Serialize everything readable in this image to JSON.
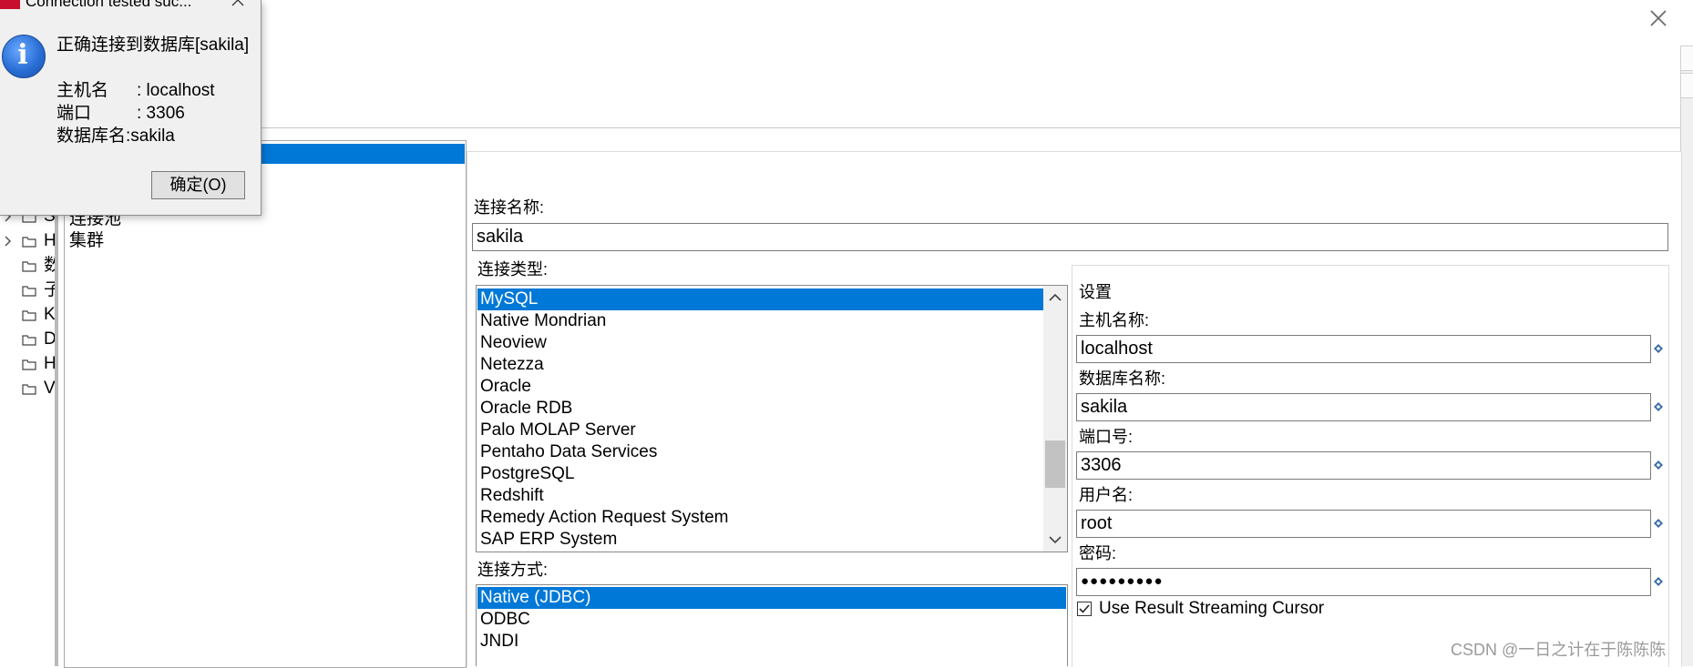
{
  "dialog": {
    "title": "Connection tested suc...",
    "message": "正确连接到数据库[sakila]",
    "host_label": "主机名",
    "host_value": ": localhost",
    "port_label": "端口",
    "port_value": ": 3306",
    "db_line": "数据库名:sakila",
    "ok_label": "确定(O)"
  },
  "tree": {
    "items": [
      {
        "label": "S",
        "expandable": true
      },
      {
        "label": "H",
        "expandable": true
      },
      {
        "label": "数",
        "expandable": false
      },
      {
        "label": "子",
        "expandable": false
      },
      {
        "label": "K",
        "expandable": false
      },
      {
        "label": "D",
        "expandable": false
      },
      {
        "label": "H",
        "expandable": false
      },
      {
        "label": "V",
        "expandable": false
      }
    ]
  },
  "categories": {
    "items": [
      "连接池",
      "集群"
    ]
  },
  "form": {
    "connection_name_label": "连接名称:",
    "connection_name_value": "sakila",
    "connection_type_label": "连接类型:",
    "connection_types": [
      "MySQL",
      "Native Mondrian",
      "Neoview",
      "Netezza",
      "Oracle",
      "Oracle RDB",
      "Palo MOLAP Server",
      "Pentaho Data Services",
      "PostgreSQL",
      "Redshift",
      "Remedy Action Request System",
      "SAP ERP System"
    ],
    "selected_type": "MySQL",
    "access_label": "连接方式:",
    "access_methods": [
      "Native (JDBC)",
      "ODBC",
      "JNDI"
    ],
    "selected_access": "Native (JDBC)"
  },
  "settings": {
    "title": "设置",
    "host_label": "主机名称:",
    "host_value": "localhost",
    "db_label": "数据库名称:",
    "db_value": "sakila",
    "port_label": "端口号:",
    "port_value": "3306",
    "user_label": "用户名:",
    "user_value": "root",
    "password_label": "密码:",
    "password_value": "●●●●●●●●●",
    "streaming_label": "Use Result Streaming Cursor",
    "streaming_checked": true
  },
  "watermark": "CSDN @一日之计在于陈陈陈",
  "colors": {
    "selection": "#0078d7",
    "dialog_bg": "#f0f0f0"
  }
}
